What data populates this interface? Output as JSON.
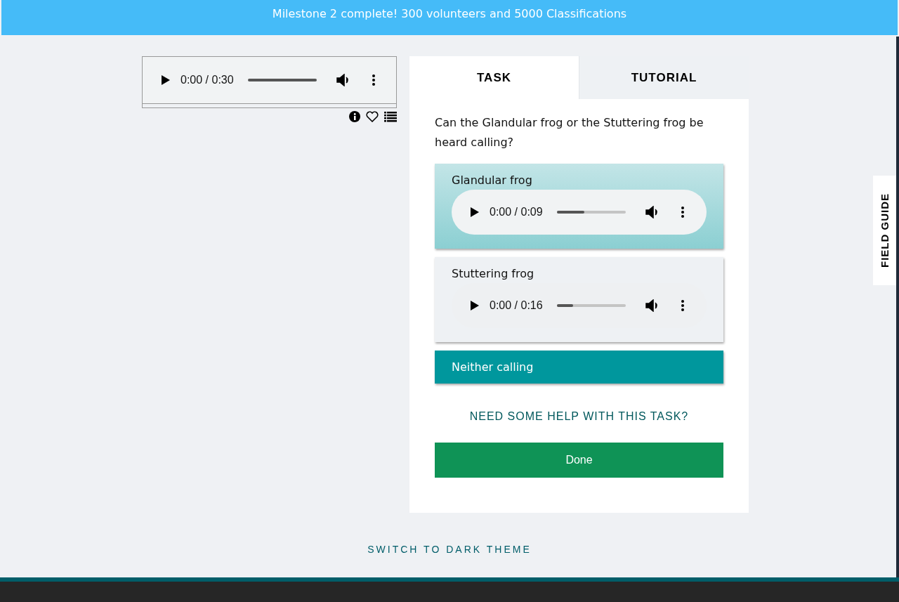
{
  "banner": {
    "text": "Milestone 2 complete! 300 volunteers and 5000 Classifications"
  },
  "subject_player": {
    "time": "0:00 / 0:30"
  },
  "tabs": [
    {
      "label": "TASK",
      "selected": true
    },
    {
      "label": "TUTORIAL",
      "selected": false
    }
  ],
  "question": "Can the Glandular frog or the Stuttering frog be heard calling?",
  "answers": [
    {
      "kind": "audio",
      "label": "Glandular frog",
      "highlighted": true,
      "time": "0:00 / 0:09",
      "level": 0.4
    },
    {
      "kind": "audio",
      "label": "Stuttering frog",
      "highlighted": false,
      "time": "0:00 / 0:16",
      "level": 0.24
    },
    {
      "kind": "text",
      "label": "Neither calling",
      "highlighted": true
    }
  ],
  "help_link": "NEED SOME HELP WITH THIS TASK?",
  "done_button": "Done",
  "field_guide": "FIELD GUIDE",
  "theme_link": "SWITCH TO DARK THEME"
}
